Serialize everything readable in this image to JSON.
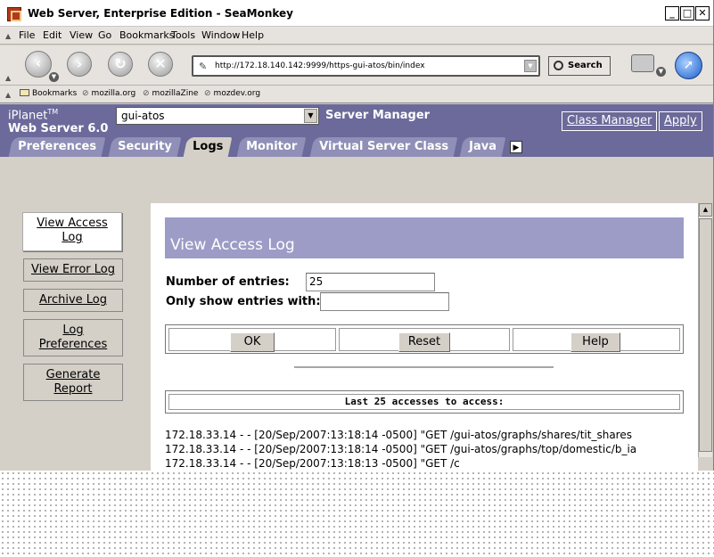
{
  "window": {
    "title": "Web Server, Enterprise Edition - SeaMonkey",
    "controls": [
      "_",
      "□",
      "✕"
    ]
  },
  "menubar": {
    "items": [
      "File",
      "Edit",
      "View",
      "Go",
      "Bookmarks",
      "Tools",
      "Window",
      "Help"
    ]
  },
  "navbar": {
    "url": "http://172.18.140.142:9999/https-gui-atos/bin/index",
    "search_label": "Search"
  },
  "bookmarks": {
    "items": [
      "Bookmarks",
      "mozilla.org",
      "mozillaZine",
      "mozdev.org"
    ]
  },
  "iplanet": {
    "brand": "iPlanet",
    "tm": "TM",
    "product": "Web Server 6.0",
    "server_selected": "gui-atos",
    "manager_label": "Server Manager",
    "class_manager_label": "Class Manager",
    "apply_label": "Apply",
    "tabs": [
      "Preferences",
      "Security",
      "Logs",
      "Monitor",
      "Virtual Server Class",
      "Java"
    ],
    "active_tab": "Logs"
  },
  "leftnav": {
    "items": [
      {
        "line1": "View Access",
        "line2": "Log"
      },
      {
        "line1": "View Error Log",
        "line2": ""
      },
      {
        "line1": "Archive Log",
        "line2": ""
      },
      {
        "line1": "Log",
        "line2": "Preferences"
      },
      {
        "line1": "Generate",
        "line2": "Report"
      }
    ]
  },
  "main": {
    "heading": "View Access Log",
    "entries_label": "Number of entries:",
    "entries_value": "25",
    "filter_label": "Only show entries with:",
    "filter_value": "",
    "ok_label": "OK",
    "reset_label": "Reset",
    "help_label": "Help",
    "count_heading": "Last 25 accesses to access:",
    "log_lines": [
      "172.18.33.14 - - [20/Sep/2007:13:18:14 -0500] \"GET /gui-atos/graphs/shares/tit_shares",
      "172.18.33.14 - - [20/Sep/2007:13:18:14 -0500] \"GET /gui-atos/graphs/top/domestic/b_ia",
      "172.18.33.14 - - [20/Sep/2007:13:18:13 -0500] \"GET /c"
    ]
  }
}
